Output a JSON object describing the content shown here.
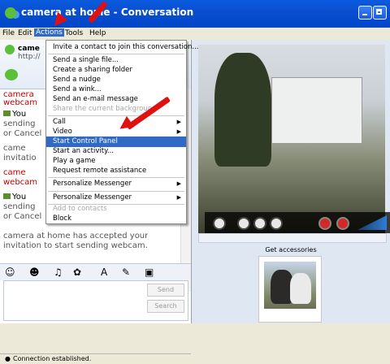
{
  "window": {
    "title": "camera at home - Conversation"
  },
  "menubar": {
    "items": [
      "File",
      "Edit",
      "Actions",
      "Tools",
      "Help"
    ]
  },
  "contact": {
    "name": "came",
    "url": "http://"
  },
  "menu": {
    "items": [
      {
        "label": "Invite a contact to join this conversation...",
        "enabled": true,
        "submenu": false
      },
      {
        "label": "Send a single file...",
        "enabled": true,
        "submenu": false
      },
      {
        "label": "Create a sharing folder",
        "enabled": true,
        "submenu": false
      },
      {
        "label": "Send a nudge",
        "enabled": true,
        "submenu": false
      },
      {
        "label": "Send a wink...",
        "enabled": true,
        "submenu": false
      },
      {
        "label": "Send an e-mail message",
        "enabled": true,
        "submenu": false
      },
      {
        "label": "Share the current background",
        "enabled": false,
        "submenu": false
      },
      {
        "label": "Call",
        "enabled": true,
        "submenu": true
      },
      {
        "label": "Video",
        "enabled": true,
        "submenu": true
      },
      {
        "label": "Start Control Panel",
        "enabled": true,
        "submenu": false,
        "highlighted": true
      },
      {
        "label": "Start an activity...",
        "enabled": true,
        "submenu": false
      },
      {
        "label": "Play a game",
        "enabled": true,
        "submenu": false
      },
      {
        "label": "Request remote assistance",
        "enabled": true,
        "submenu": false
      },
      {
        "label": "Personalize Messenger",
        "enabled": true,
        "submenu": true
      },
      {
        "label": "Personalize Messenger",
        "enabled": true,
        "submenu": true
      },
      {
        "label": "Add to contacts",
        "enabled": false,
        "submenu": false
      },
      {
        "label": "Block",
        "enabled": true,
        "submenu": false
      }
    ]
  },
  "chat": {
    "lines": [
      {
        "text": "camera",
        "style": "red"
      },
      {
        "text": "webcam",
        "style": "red"
      },
      {
        "text": "You",
        "style": "normal"
      },
      {
        "text": "sending",
        "style": "gray"
      },
      {
        "text": "or Cancel",
        "style": "gray"
      },
      {
        "text": "came",
        "style": "gray"
      },
      {
        "text": "invitatio",
        "style": "gray"
      },
      {
        "text": "came",
        "style": "red"
      },
      {
        "text": "webcam",
        "style": "red"
      },
      {
        "text": "You",
        "style": "normal"
      },
      {
        "text": "sending",
        "style": "gray"
      },
      {
        "text": "or Cancel",
        "style": "gray"
      },
      {
        "text": "camera at home has accepted your",
        "style": "gray"
      },
      {
        "text": "invitation to start sending webcam.",
        "style": "gray"
      }
    ]
  },
  "compose": {
    "send_label": "Send",
    "search_label": "Search"
  },
  "status": {
    "text": "Connection established."
  },
  "accessories": {
    "label": "Get accessories"
  },
  "colors": {
    "titlebar": "#0054e3",
    "highlight": "#316ac5",
    "annotation_arrow": "#e01010"
  },
  "icons": [
    "messenger-icon",
    "minimize-icon",
    "maximize-icon",
    "zoom-icon",
    "pause-icon",
    "stop-icon",
    "record-icon",
    "end-call-icon",
    "volume-icon"
  ]
}
